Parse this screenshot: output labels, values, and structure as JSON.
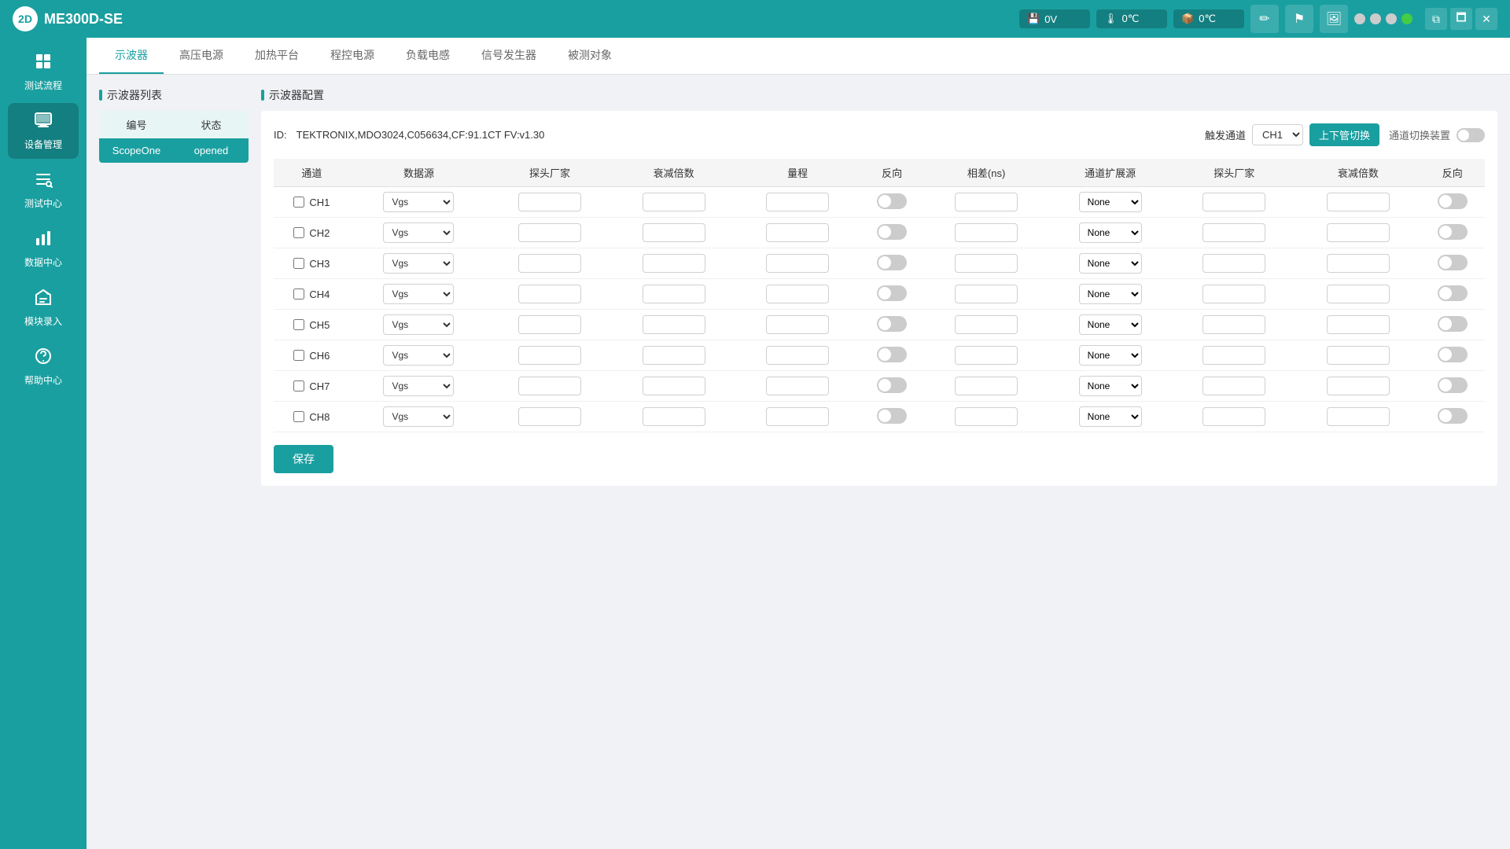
{
  "app": {
    "title": "ME300D-SE",
    "logo_text": "2D"
  },
  "topbar": {
    "sensor1": {
      "icon": "💾",
      "label": "0V"
    },
    "sensor2": {
      "icon": "🌡",
      "label": "0℃"
    },
    "sensor3": {
      "icon": "📦",
      "label": "0℃"
    },
    "btn_pen": "✏",
    "btn_flag": "🚩",
    "btn_save": "💾",
    "dots": [
      "#cccccc",
      "#cccccc",
      "#cccccc",
      "#44cc44"
    ],
    "win_restore": "⧉",
    "win_max": "🗖",
    "win_close": "✕"
  },
  "sidebar": {
    "items": [
      {
        "id": "test-flow",
        "icon": "⚙",
        "label": "测试流程"
      },
      {
        "id": "device-manage",
        "icon": "🖥",
        "label": "设备管理"
      },
      {
        "id": "test-center",
        "icon": "≡",
        "label": "测试中心"
      },
      {
        "id": "data-center",
        "icon": "📊",
        "label": "数据中心"
      },
      {
        "id": "module-entry",
        "icon": "✏",
        "label": "模块录入"
      },
      {
        "id": "help-center",
        "icon": "❓",
        "label": "帮助中心"
      }
    ]
  },
  "tabs": [
    {
      "id": "oscilloscope",
      "label": "示波器",
      "active": true
    },
    {
      "id": "high-voltage",
      "label": "高压电源"
    },
    {
      "id": "heating",
      "label": "加热平台"
    },
    {
      "id": "prog-power",
      "label": "程控电源"
    },
    {
      "id": "load-power",
      "label": "负载电感"
    },
    {
      "id": "signal-gen",
      "label": "信号发生器"
    },
    {
      "id": "test-target",
      "label": "被测对象"
    }
  ],
  "left_panel": {
    "title": "示波器列表",
    "header": {
      "col1": "编号",
      "col2": "状态"
    },
    "rows": [
      {
        "id": "ScopeOne",
        "status": "opened"
      }
    ]
  },
  "config_panel": {
    "title": "示波器配置",
    "id_label": "ID:",
    "id_value": "TEKTRONIX,MDO3024,C056634,CF:91.1CT FV:v1.30",
    "trigger_label": "触发通道",
    "trigger_value": "CH1",
    "switch_btn_label": "上下管切换",
    "channel_switch_label": "通道切换装置",
    "table": {
      "headers": [
        "通道",
        "数据源",
        "探头厂家",
        "衰减倍数",
        "量程",
        "反向",
        "相差(ns)",
        "通道扩展源",
        "探头厂家",
        "衰减倍数",
        "反向"
      ],
      "rows": [
        {
          "ch": "CH1",
          "source": "Vgs",
          "probe": "",
          "attn": "",
          "range": "",
          "invert": false,
          "delay": "",
          "ext_source": "None",
          "ext_probe": "",
          "ext_attn": "",
          "ext_invert": false
        },
        {
          "ch": "CH2",
          "source": "Vgs",
          "probe": "",
          "attn": "",
          "range": "",
          "invert": false,
          "delay": "",
          "ext_source": "None",
          "ext_probe": "",
          "ext_attn": "",
          "ext_invert": false
        },
        {
          "ch": "CH3",
          "source": "Vgs",
          "probe": "",
          "attn": "",
          "range": "",
          "invert": false,
          "delay": "",
          "ext_source": "None",
          "ext_probe": "",
          "ext_attn": "",
          "ext_invert": false
        },
        {
          "ch": "CH4",
          "source": "Vgs",
          "probe": "",
          "attn": "",
          "range": "",
          "invert": false,
          "delay": "",
          "ext_source": "None",
          "ext_probe": "",
          "ext_attn": "",
          "ext_invert": false
        },
        {
          "ch": "CH5",
          "source": "Vgs",
          "probe": "",
          "attn": "",
          "range": "",
          "invert": false,
          "delay": "",
          "ext_source": "None",
          "ext_probe": "",
          "ext_attn": "",
          "ext_invert": false
        },
        {
          "ch": "CH6",
          "source": "Vgs",
          "probe": "",
          "attn": "",
          "range": "",
          "invert": false,
          "delay": "",
          "ext_source": "None",
          "ext_probe": "",
          "ext_attn": "",
          "ext_invert": false
        },
        {
          "ch": "CH7",
          "source": "Vgs",
          "probe": "",
          "attn": "",
          "range": "",
          "invert": false,
          "delay": "",
          "ext_source": "None",
          "ext_probe": "",
          "ext_attn": "",
          "ext_invert": false
        },
        {
          "ch": "CH8",
          "source": "Vgs",
          "probe": "",
          "attn": "",
          "range": "",
          "invert": false,
          "delay": "",
          "ext_source": "None",
          "ext_probe": "",
          "ext_attn": "",
          "ext_invert": false
        }
      ]
    },
    "save_btn_label": "保存"
  }
}
